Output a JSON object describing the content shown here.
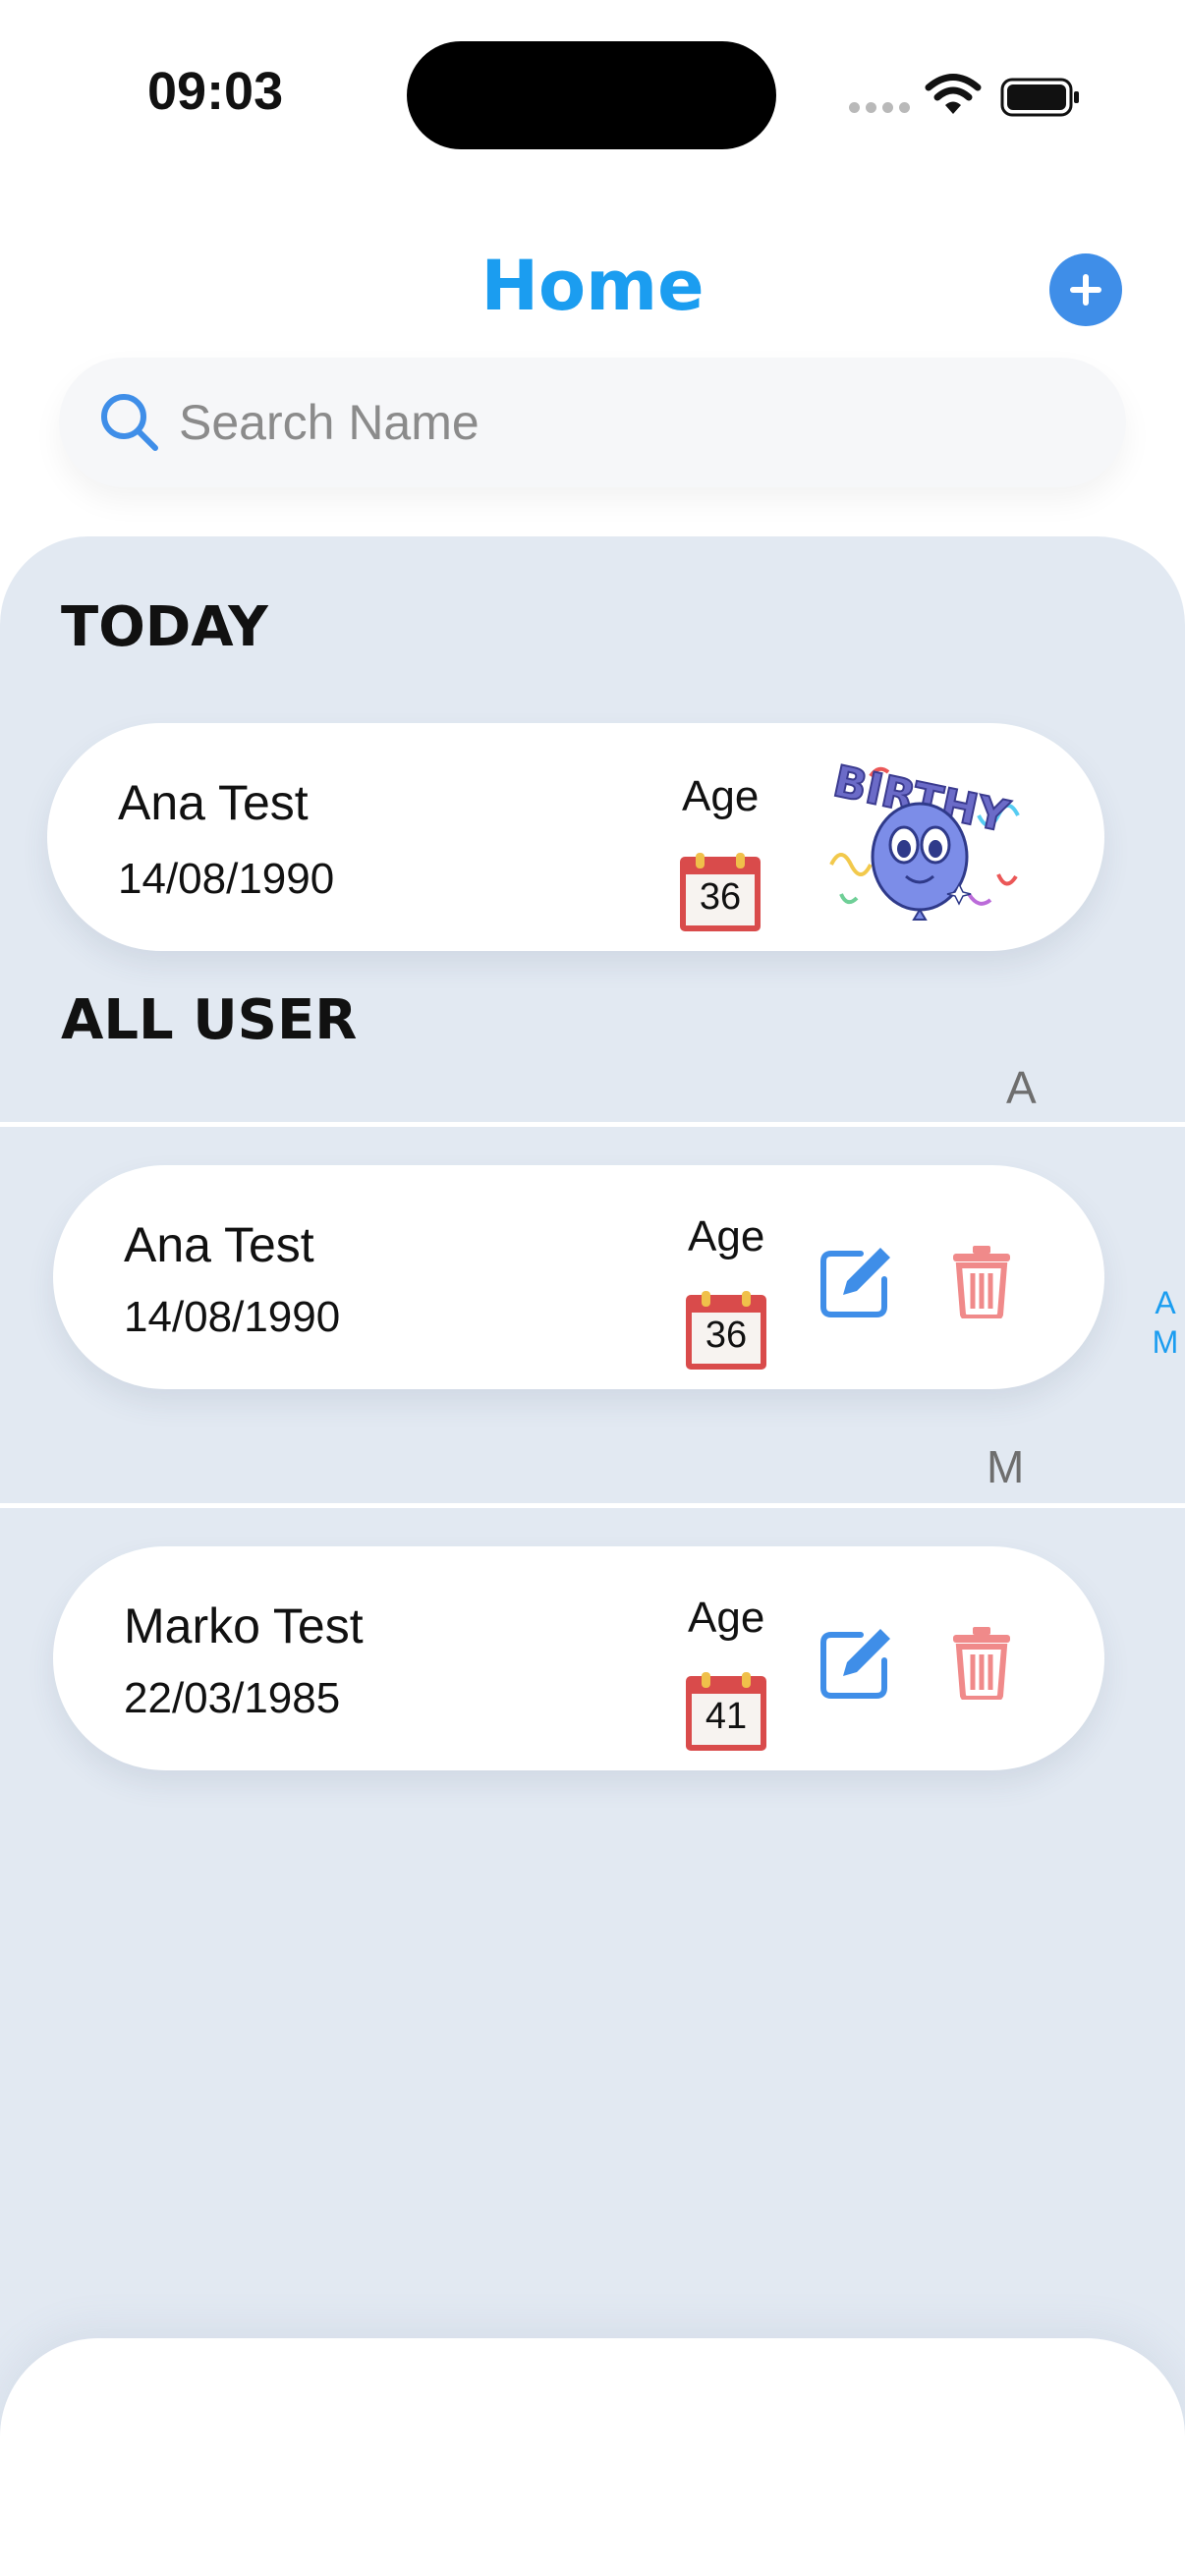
{
  "status_bar": {
    "time": "09:03"
  },
  "header": {
    "title": "Home",
    "add_icon": "plus-icon"
  },
  "search": {
    "placeholder": "Search Name",
    "value": ""
  },
  "today": {
    "section_title": "TODAY",
    "users": [
      {
        "name": "Ana Test",
        "birthdate": "14/08/1990",
        "age_label": "Age",
        "age": "36",
        "image": "birthday-balloon"
      }
    ]
  },
  "all_users": {
    "section_title": "ALL USER",
    "groups": [
      {
        "letter": "A",
        "users": [
          {
            "name": "Ana Test",
            "birthdate": "14/08/1990",
            "age_label": "Age",
            "age": "36"
          }
        ]
      },
      {
        "letter": "M",
        "users": [
          {
            "name": "Marko Test",
            "birthdate": "22/03/1985",
            "age_label": "Age",
            "age": "41"
          }
        ]
      }
    ]
  },
  "index_bar": [
    "A",
    "M"
  ],
  "colors": {
    "accent": "#1b9df0",
    "add_button": "#3f8ee8",
    "edit": "#3f8ee8",
    "delete": "#f08a8a",
    "panel": "#e2e9f2",
    "calendar": "#d94b4b"
  }
}
